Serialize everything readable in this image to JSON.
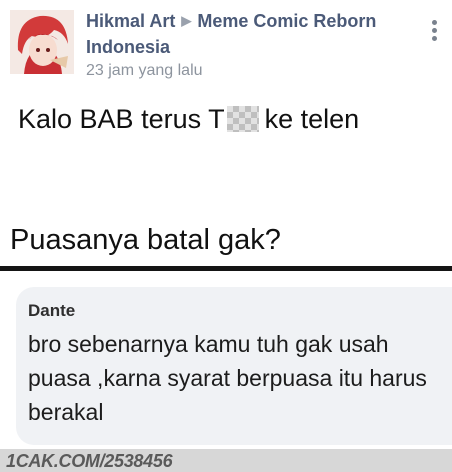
{
  "post": {
    "author": "Hikmal Art",
    "target_group": "Meme Comic Reborn Indonesia",
    "timestamp": "23 jam yang lalu",
    "text_line1_before": "Kalo BAB terus T",
    "text_line1_after": "ke telen",
    "text_line2": "Puasanya batal gak?"
  },
  "comment": {
    "author": "Dante",
    "body": "bro sebenarnya kamu tuh gak usah puasa ,karna syarat berpuasa itu harus berakal"
  },
  "watermark": {
    "text": "1CAK.COM/2538456"
  },
  "icons": {
    "separator": "triangle-right",
    "more": "vertical-ellipsis"
  },
  "colors": {
    "author_link": "#4b5a78",
    "timestamp": "#8d949e",
    "comment_bubble": "#f0f2f5",
    "divider": "#151515"
  }
}
